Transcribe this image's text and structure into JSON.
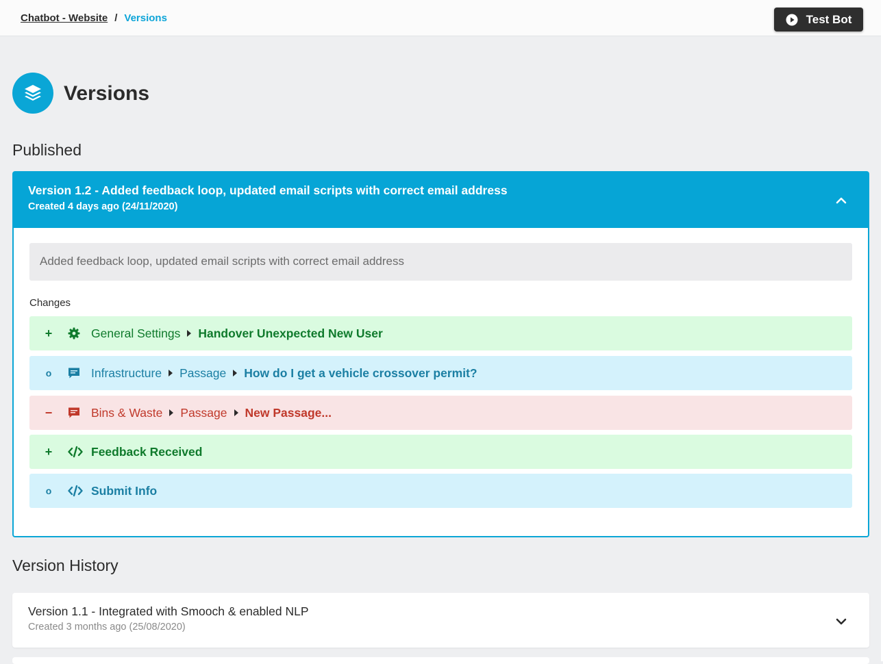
{
  "breadcrumb": {
    "parent": "Chatbot - Website",
    "separator": "/",
    "current": "Versions"
  },
  "toolbar": {
    "test_bot_label": "Test Bot",
    "test_bot_icon": "play-circle-icon"
  },
  "page": {
    "title": "Versions",
    "icon": "layers-icon"
  },
  "published": {
    "section_title": "Published",
    "title": "Version 1.2 - Added feedback loop, updated email scripts with correct email address",
    "created": "Created 4 days ago (24/11/2020)",
    "description": "Added feedback loop, updated email scripts with correct email address",
    "changes_label": "Changes",
    "changes": [
      {
        "type": "add",
        "marker": "+",
        "icon": "gear-icon",
        "path": [
          "General Settings"
        ],
        "item": "Handover Unexpected New User"
      },
      {
        "type": "mod",
        "marker": "o",
        "icon": "chat-icon",
        "path": [
          "Infrastructure",
          "Passage"
        ],
        "item": "How do I get a vehicle crossover permit?"
      },
      {
        "type": "del",
        "marker": "−",
        "icon": "chat-icon",
        "path": [
          "Bins & Waste",
          "Passage"
        ],
        "item": "New Passage..."
      },
      {
        "type": "add",
        "marker": "+",
        "icon": "code-icon",
        "path": [],
        "item": "Feedback Received"
      },
      {
        "type": "mod",
        "marker": "o",
        "icon": "code-icon",
        "path": [],
        "item": "Submit Info"
      }
    ]
  },
  "history": {
    "section_title": "Version History",
    "items": [
      {
        "title": "Version 1.1 - Integrated with Smooch & enabled NLP",
        "created": "Created 3 months ago (25/08/2020)"
      }
    ]
  },
  "colors": {
    "accent": "#06a5d6",
    "add_bg": "#dafbe0",
    "add_fg": "#0f7a2c",
    "mod_bg": "#d4f2fc",
    "mod_fg": "#1b7fa3",
    "del_bg": "#f9e4e5",
    "del_fg": "#c0392b"
  }
}
